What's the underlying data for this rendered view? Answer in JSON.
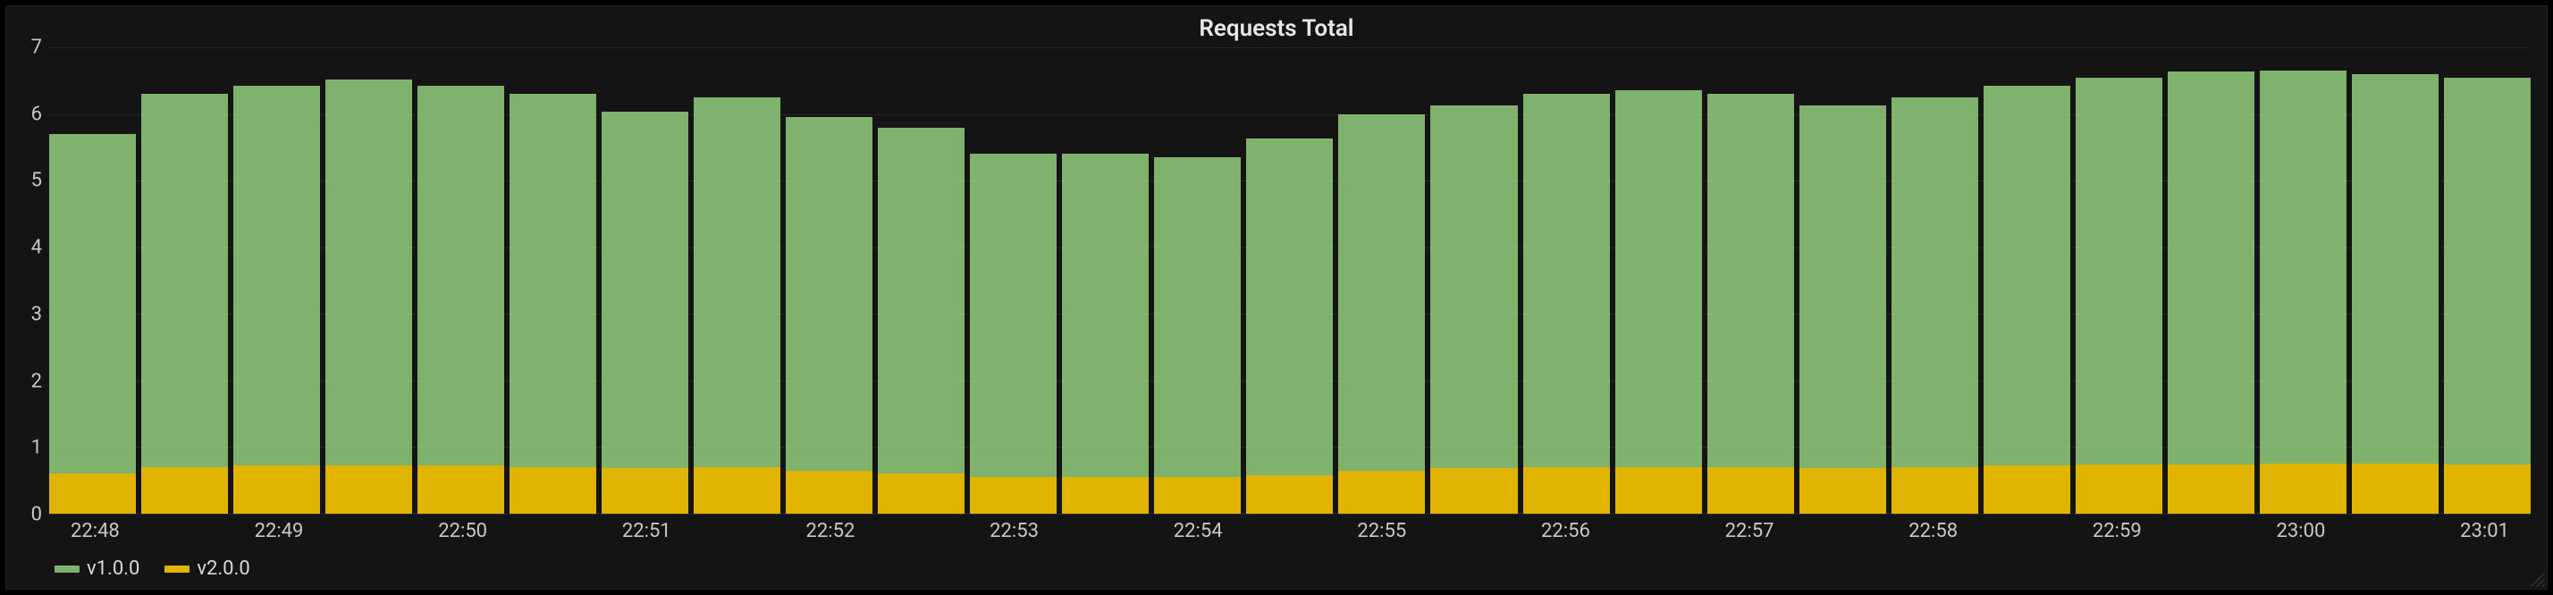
{
  "title": "Requests Total",
  "colors": {
    "v1": "#7eb26d",
    "v2": "#e0b400"
  },
  "chart_data": {
    "type": "bar",
    "stacked": true,
    "title": "Requests Total",
    "xlabel": "",
    "ylabel": "",
    "ylim": [
      0,
      7
    ],
    "yticks": [
      0,
      1,
      2,
      3,
      4,
      5,
      6,
      7
    ],
    "x_tick_labels": [
      "22:48",
      "22:49",
      "22:50",
      "22:51",
      "22:52",
      "22:53",
      "22:54",
      "22:55",
      "22:56",
      "22:57",
      "22:58",
      "22:59",
      "23:00",
      "23:01"
    ],
    "x_tick_positions": [
      0,
      2,
      4,
      6,
      8,
      10,
      12,
      14,
      16,
      18,
      20,
      22,
      24,
      26
    ],
    "series": [
      {
        "name": "v1.0.0",
        "color": "#7eb26d",
        "values": [
          5.1,
          5.6,
          5.7,
          5.8,
          5.7,
          5.6,
          5.35,
          5.55,
          5.3,
          5.2,
          4.85,
          4.85,
          4.8,
          5.05,
          5.35,
          5.45,
          5.6,
          5.65,
          5.6,
          5.45,
          5.55,
          5.7,
          5.8,
          5.9,
          5.9,
          5.85,
          5.8
        ]
      },
      {
        "name": "v2.0.0",
        "color": "#e0b400",
        "values": [
          0.6,
          0.7,
          0.72,
          0.72,
          0.72,
          0.7,
          0.68,
          0.7,
          0.65,
          0.6,
          0.55,
          0.55,
          0.55,
          0.58,
          0.65,
          0.68,
          0.7,
          0.7,
          0.7,
          0.68,
          0.7,
          0.72,
          0.74,
          0.74,
          0.75,
          0.75,
          0.74
        ]
      }
    ],
    "stacked_totals": [
      5.7,
      6.3,
      6.42,
      6.52,
      6.42,
      6.3,
      6.03,
      6.25,
      5.95,
      5.8,
      5.4,
      5.4,
      5.35,
      5.63,
      6.0,
      6.13,
      6.3,
      6.35,
      6.3,
      6.13,
      6.25,
      6.42,
      6.54,
      6.64,
      6.65,
      6.6,
      6.54
    ]
  },
  "legend": [
    {
      "label": "v1.0.0",
      "color": "#7eb26d"
    },
    {
      "label": "v2.0.0",
      "color": "#e0b400"
    }
  ]
}
